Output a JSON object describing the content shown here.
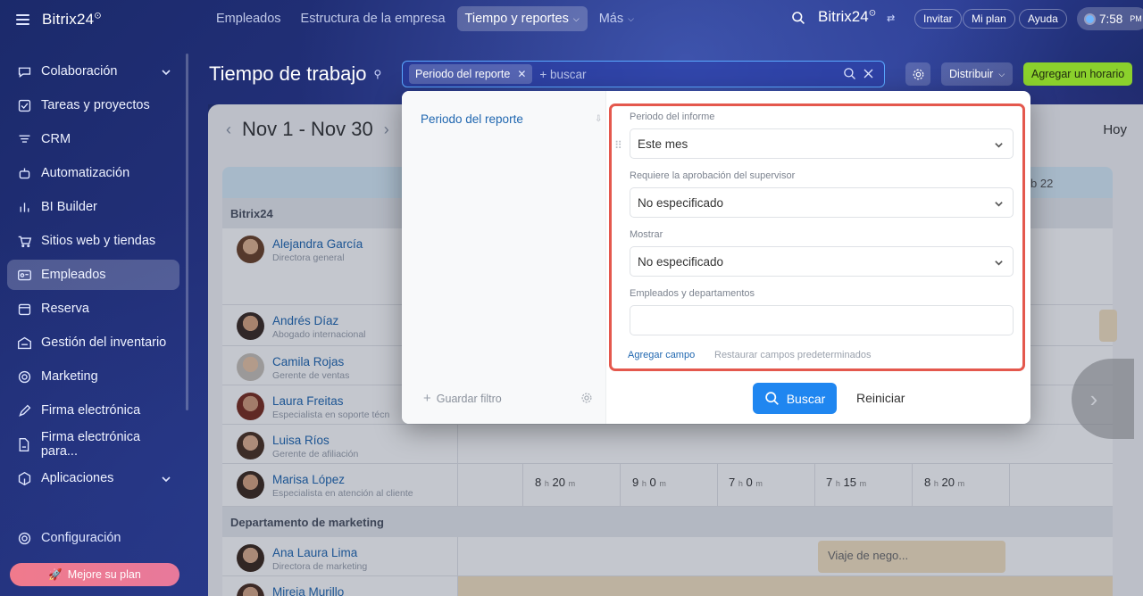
{
  "sidebar": {
    "logo": "Bitrix24",
    "items": [
      {
        "label": "Colaboración",
        "icon": "chat-icon",
        "chevron": true
      },
      {
        "label": "Tareas y proyectos",
        "icon": "checkbox-icon"
      },
      {
        "label": "CRM",
        "icon": "funnel-icon"
      },
      {
        "label": "Automatización",
        "icon": "robot-icon"
      },
      {
        "label": "BI Builder",
        "icon": "bar-chart-icon"
      },
      {
        "label": "Sitios web y tiendas",
        "icon": "cart-icon"
      },
      {
        "label": "Empleados",
        "icon": "id-card-icon",
        "active": true
      },
      {
        "label": "Reserva",
        "icon": "calendar-icon"
      },
      {
        "label": "Gestión del inventario",
        "icon": "warehouse-icon"
      },
      {
        "label": "Marketing",
        "icon": "target-icon"
      },
      {
        "label": "Firma electrónica",
        "icon": "pen-icon"
      },
      {
        "label": "Firma electrónica para...",
        "icon": "document-sign-icon"
      },
      {
        "label": "Aplicaciones",
        "icon": "cube-icon",
        "chevron": true
      }
    ],
    "settings_label": "Configuración",
    "upgrade_label": "Mejore su plan"
  },
  "topnav": {
    "items": [
      "Empleados",
      "Estructura de la empresa",
      "Tiempo y reportes",
      "Más"
    ],
    "active": "Tiempo y reportes",
    "brand": "Bitrix24",
    "invite": "Invitar",
    "my_plan": "Mi plan",
    "help": "Ayuda",
    "time": "7:58",
    "ampm": "PM"
  },
  "header": {
    "title": "Tiempo de trabajo",
    "filter_chip": "Periodo del reporte",
    "search_placeholder": "+ buscar",
    "distribute": "Distribuir",
    "add_schedule": "Agregar un horario"
  },
  "calendar": {
    "period": "Nov 1 - Nov 30",
    "today": "Hoy",
    "visible_day": "b 22",
    "company": "Bitrix24",
    "employees": [
      {
        "name": "Alejandra García",
        "role": "Directora general"
      },
      {
        "name": "Andrés Díaz",
        "role": "Abogado internacional"
      },
      {
        "name": "Camila Rojas",
        "role": "Gerente de ventas"
      },
      {
        "name": "Laura Freitas",
        "role": "Especialista en soporte técn"
      },
      {
        "name": "Luisa Ríos",
        "role": "Gerente de afiliación"
      },
      {
        "name": "Marisa López",
        "role": "Especialista en atención al cliente",
        "hours": [
          {
            "h": "8",
            "m": "20"
          },
          {
            "h": "9",
            "m": "0"
          },
          {
            "h": "7",
            "m": "0"
          },
          {
            "h": "7",
            "m": "15"
          },
          {
            "h": "8",
            "m": "20"
          }
        ]
      }
    ],
    "department": "Departamento de marketing",
    "marketing_employees": [
      {
        "name": "Ana Laura Lima",
        "role": "Directora de marketing",
        "event": "Viaje de nego..."
      },
      {
        "name": "Mireia Murillo",
        "role": ""
      }
    ],
    "h_unit": "h",
    "m_unit": "m"
  },
  "filter_popup": {
    "preset": "Periodo del reporte",
    "save_filter": "Guardar filtro",
    "fields": [
      {
        "label": "Periodo del informe",
        "value": "Este mes"
      },
      {
        "label": "Requiere la aprobación del supervisor",
        "value": "No especificado"
      },
      {
        "label": "Mostrar",
        "value": "No especificado"
      },
      {
        "label": "Empleados y departamentos",
        "value": ""
      }
    ],
    "add_field": "Agregar campo",
    "restore_fields": "Restaurar campos predeterminados",
    "search_button": "Buscar",
    "reset_button": "Reiniciar"
  },
  "colors": {
    "accent_blue": "#1f86f0",
    "green_button": "#8bd12c",
    "highlight_border": "#e4584d",
    "link": "#2067b0",
    "event_bg": "#f6e3c2"
  }
}
